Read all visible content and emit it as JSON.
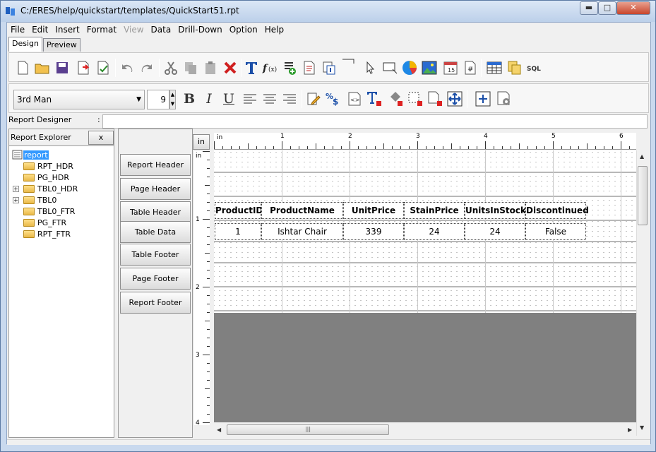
{
  "window": {
    "title": "C:/ERES/help/quickstart/templates/QuickStart51.rpt",
    "minimize": "▬",
    "maximize": "□",
    "close": "✕"
  },
  "menu": [
    "File",
    "Edit",
    "Insert",
    "Format",
    "View",
    "Data",
    "Drill-Down",
    "Option",
    "Help"
  ],
  "tabs": [
    "Design",
    "Preview"
  ],
  "format_toolbar": {
    "font": "3rd Man",
    "font_size": "9",
    "bold": "B",
    "italic": "I",
    "underline": "U"
  },
  "designer": {
    "label": "Report Designer",
    "colon": ":",
    "value": ""
  },
  "explorer": {
    "title": "Report Explorer",
    "close": "x",
    "root": "report",
    "nodes": [
      "RPT_HDR",
      "PG_HDR",
      "TBL0_HDR",
      "TBL0",
      "TBL0_FTR",
      "PG_FTR",
      "RPT_FTR"
    ]
  },
  "bands": [
    "Report Header",
    "Page Header",
    "Table Header",
    "Table Data",
    "Table Footer",
    "Page Footer",
    "Report Footer"
  ],
  "unit_button": "in",
  "ruler": {
    "unit": "in",
    "h_marks": [
      "1",
      "2",
      "3",
      "4",
      "5",
      "6"
    ],
    "v_marks": [
      "1",
      "2",
      "3",
      "4"
    ]
  },
  "table": {
    "headers": [
      "ProductID",
      "ProductName",
      "UnitPrice",
      "StainPrice",
      "UnitsInStock",
      "Discontinued"
    ],
    "row": [
      "1",
      "Ishtar Chair",
      "339",
      "24",
      "24",
      "False"
    ]
  },
  "scrollbar_grip": "|||"
}
